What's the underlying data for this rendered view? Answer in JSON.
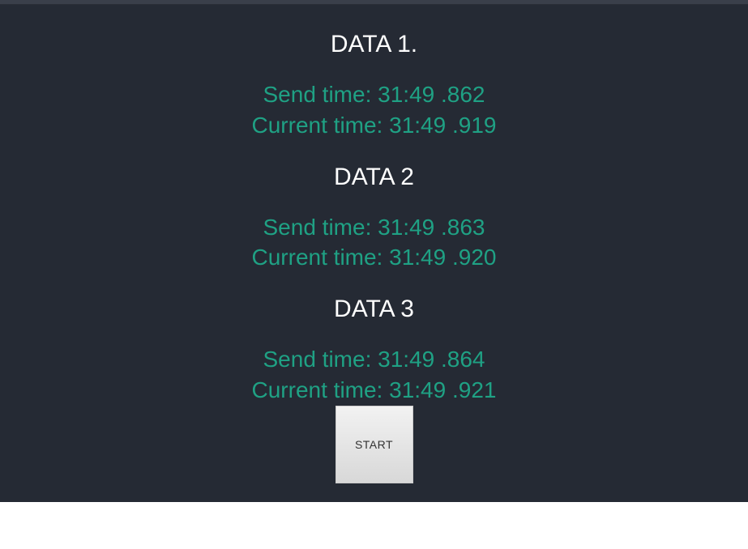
{
  "blocks": [
    {
      "title": "DATA 1.",
      "send_label": "Send time: ",
      "send_value": "31:49 .862",
      "current_label": "Current time: ",
      "current_value": "31:49 .919"
    },
    {
      "title": "DATA 2",
      "send_label": "Send time: ",
      "send_value": "31:49 .863",
      "current_label": "Current time: ",
      "current_value": "31:49 .920"
    },
    {
      "title": "DATA 3",
      "send_label": "Send time: ",
      "send_value": "31:49 .864",
      "current_label": "Current time: ",
      "current_value": "31:49 .921"
    }
  ],
  "button": {
    "label": "START"
  }
}
